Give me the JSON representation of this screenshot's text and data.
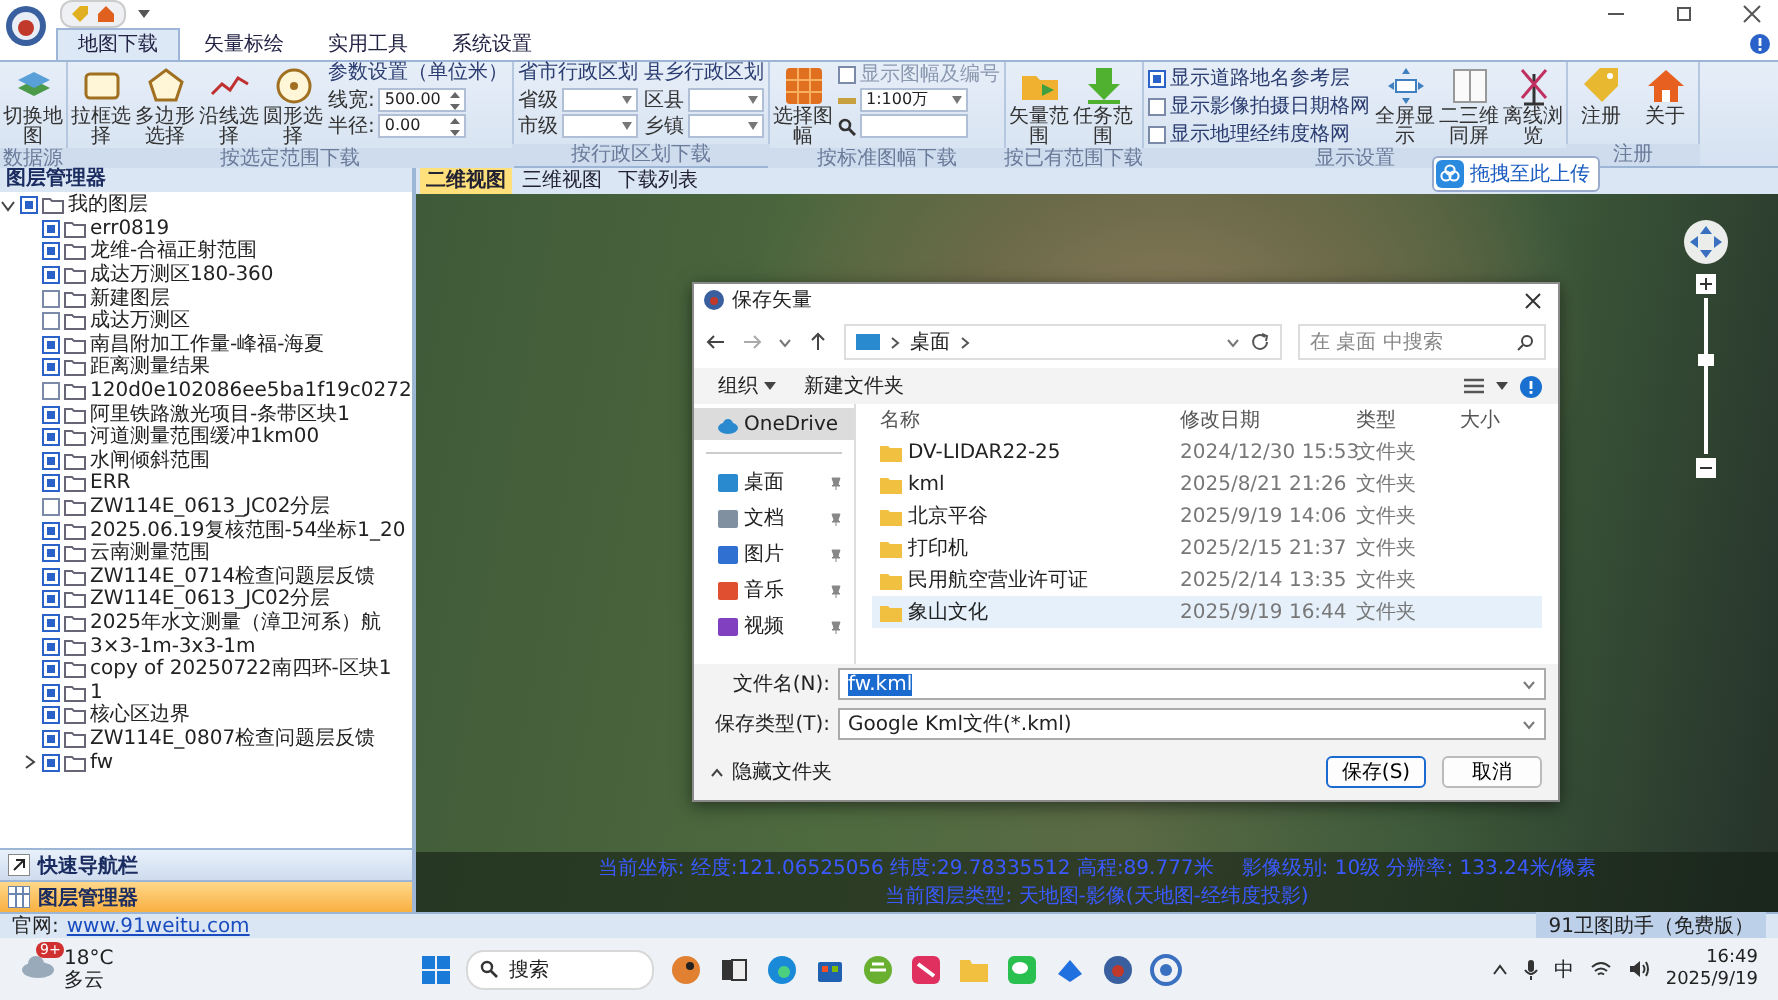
{
  "ribbon_tabs": [
    {
      "label": "地图下载",
      "selected": true
    },
    {
      "label": "矢量标绘",
      "selected": false
    },
    {
      "label": "实用工具",
      "selected": false
    },
    {
      "label": "系统设置",
      "selected": false
    }
  ],
  "ribbon_groups": [
    {
      "label": "数据源",
      "columns": [
        {
          "kind": "big",
          "label": "切换地图"
        }
      ]
    },
    {
      "label": "按选定范围下载",
      "columns": [
        {
          "kind": "big",
          "label": "拉框选择"
        },
        {
          "kind": "big",
          "label": "多边形选择"
        },
        {
          "kind": "big",
          "label": "沿线选择"
        },
        {
          "kind": "big",
          "label": "圆形选择"
        },
        {
          "kind": "params",
          "title": "参数设置（单位米）",
          "rows": [
            {
              "label": "线宽:",
              "value": "500.00"
            },
            {
              "label": "半径:",
              "value": "0.00"
            }
          ]
        }
      ]
    },
    {
      "label": "按行政区划下载",
      "columns": [
        {
          "kind": "region",
          "title": "省市行政区划",
          "rows": [
            {
              "label": "省级"
            },
            {
              "label": "市级"
            }
          ]
        },
        {
          "kind": "region",
          "title": "县乡行政区划",
          "rows": [
            {
              "label": "区县"
            },
            {
              "label": "乡镇"
            }
          ]
        }
      ]
    },
    {
      "label": "按标准图幅下载",
      "columns": [
        {
          "kind": "big",
          "label": "选择图幅"
        },
        {
          "kind": "scale",
          "check": {
            "label": "显示图幅及编号",
            "checked": false
          },
          "scale": "1:100万"
        }
      ]
    },
    {
      "label": "按已有范围下载",
      "columns": [
        {
          "kind": "big",
          "label": "矢量范围"
        },
        {
          "kind": "big",
          "label": "任务范围"
        }
      ]
    },
    {
      "label": "显示设置",
      "columns": [
        {
          "kind": "checks",
          "items": [
            {
              "label": "显示道路地名参考层",
              "checked": true
            },
            {
              "label": "显示影像拍摄日期格网",
              "checked": false
            },
            {
              "label": "显示地理经纬度格网",
              "checked": false
            }
          ]
        },
        {
          "kind": "big",
          "label": "全屏显示"
        },
        {
          "kind": "big",
          "label": "二三维同屏"
        },
        {
          "kind": "big",
          "label": "离线浏览"
        }
      ]
    },
    {
      "label": "注册",
      "columns": [
        {
          "kind": "big",
          "label": "注册"
        },
        {
          "kind": "big",
          "label": "关于"
        }
      ]
    }
  ],
  "upload_badge": {
    "label": "拖拽至此上传"
  },
  "layer_panel": {
    "title": "图层管理器",
    "tree": {
      "label": "我的图层",
      "checked": true,
      "expanded": true,
      "children": [
        {
          "label": "err0819",
          "checked": true
        },
        {
          "label": "龙维-合福正射范围",
          "checked": true
        },
        {
          "label": "成达万测区180-360",
          "checked": true
        },
        {
          "label": "新建图层",
          "checked": false
        },
        {
          "label": "成达万测区",
          "checked": false
        },
        {
          "label": "南昌附加工作量-峰福-海夏",
          "checked": true
        },
        {
          "label": "距离测量结果",
          "checked": true
        },
        {
          "label": "120d0e102086ee5ba1f19c0272",
          "checked": false
        },
        {
          "label": "阿里铁路激光项目-条带区块1",
          "checked": true
        },
        {
          "label": "河道测量范围缓冲1km00",
          "checked": true
        },
        {
          "label": "水闸倾斜范围",
          "checked": true
        },
        {
          "label": "ERR",
          "checked": true
        },
        {
          "label": "ZW114E_0613_JC02分层",
          "checked": false
        },
        {
          "label": "2025.06.19复核范围-54坐标1_20",
          "checked": true
        },
        {
          "label": "云南测量范围",
          "checked": true
        },
        {
          "label": "ZW114E_0714检查问题层反馈",
          "checked": true
        },
        {
          "label": "ZW114E_0613_JC02分层",
          "checked": true
        },
        {
          "label": "2025年水文测量（漳卫河系）航",
          "checked": true
        },
        {
          "label": "3×3-1m-3x3-1m",
          "checked": true
        },
        {
          "label": "copy of 20250722南四环-区块1",
          "checked": true
        },
        {
          "label": "1",
          "checked": true
        },
        {
          "label": "核心区边界",
          "checked": true
        },
        {
          "label": "ZW114E_0807检查问题层反馈",
          "checked": true
        },
        {
          "label": "fw",
          "checked": true,
          "expanded": false
        }
      ]
    }
  },
  "nav_panels": [
    {
      "label": "快速导航栏",
      "selected": false
    },
    {
      "label": "图层管理器",
      "selected": true
    }
  ],
  "view_tabs": [
    {
      "label": "二维视图",
      "selected": true
    },
    {
      "label": "三维视图",
      "selected": false
    },
    {
      "label": "下载列表",
      "selected": false
    }
  ],
  "map": {
    "status": [
      "当前坐标: 经度:121.06525056 纬度:29.78335512 高程:89.777米",
      "影像级别: 10级 分辨率: 133.24米/像素",
      "当前图层类型: 天地图-影像(天地图-经纬度投影)"
    ]
  },
  "dialog": {
    "title": "保存矢量",
    "path": "桌面",
    "search_placeholder": "在 桌面 中搜索",
    "organize": "组织",
    "new_folder": "新建文件夹",
    "nav": [
      {
        "label": "OneDrive",
        "selected": true
      },
      {
        "label": "桌面",
        "selected": false
      },
      {
        "label": "文档",
        "selected": false
      },
      {
        "label": "图片",
        "selected": false
      },
      {
        "label": "音乐",
        "selected": false
      },
      {
        "label": "视频",
        "selected": false
      }
    ],
    "columns": [
      "名称",
      "修改日期",
      "类型",
      "大小"
    ],
    "rows": [
      {
        "name": "DV-LIDAR22-25",
        "modified": "2024/12/30 15:53",
        "type": "文件夹",
        "selected": false
      },
      {
        "name": "kml",
        "modified": "2025/8/21 21:26",
        "type": "文件夹",
        "selected": false
      },
      {
        "name": "北京平谷",
        "modified": "2025/9/19 14:06",
        "type": "文件夹",
        "selected": false
      },
      {
        "name": "打印机",
        "modified": "2025/2/15 21:37",
        "type": "文件夹",
        "selected": false
      },
      {
        "name": "民用航空营业许可证",
        "modified": "2025/2/14 13:35",
        "type": "文件夹",
        "selected": false
      },
      {
        "name": "象山文化",
        "modified": "2025/9/19 16:44",
        "type": "文件夹",
        "selected": true
      }
    ],
    "file_name_label": "文件名(N):",
    "file_name": "fw.kml",
    "file_type_label": "保存类型(T):",
    "file_type": "Google Kml文件(*.kml)",
    "hide_folders": "隐藏文件夹",
    "save": "保存(S)",
    "cancel": "取消"
  },
  "footer": {
    "site_label": "官网:",
    "site_link": "www.91weitu.com",
    "edition": "91卫图助手（免费版）"
  },
  "taskbar": {
    "weather_badge": "9+",
    "temperature": "18°C",
    "weather": "多云",
    "search_placeholder": "搜索",
    "ime": "中",
    "time": "16:49",
    "date": "2025/9/19"
  }
}
